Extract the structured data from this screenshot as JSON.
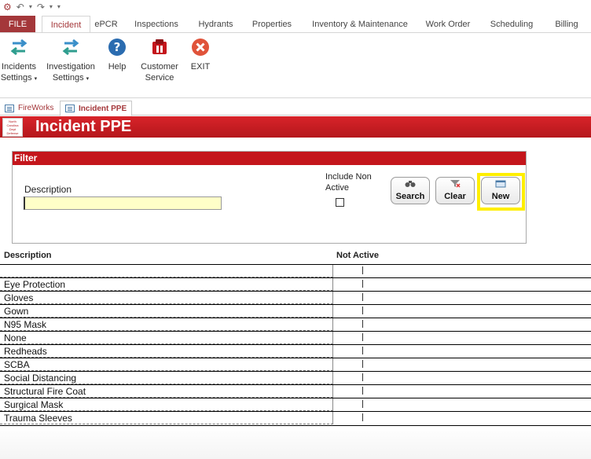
{
  "quick_access": {
    "save_icon": "app-icon",
    "undo_icon": "undo-icon",
    "redo_icon": "redo-icon",
    "customize_icon": "customize-icon"
  },
  "ribbon_tabs": [
    "FILE",
    "Incident",
    "ePCR",
    "Inspections",
    "Hydrants",
    "Properties",
    "Inventory & Maintenance",
    "Work Order",
    "Scheduling",
    "Billing"
  ],
  "ribbon_buttons": [
    {
      "line1": "Incidents",
      "line2": "Settings",
      "icon": "arrows-icon"
    },
    {
      "line1": "Investigation",
      "line2": "Settings",
      "icon": "arrows-icon"
    },
    {
      "line1": "Help",
      "line2": "",
      "icon": "help-icon"
    },
    {
      "line1": "Customer",
      "line2": "Service",
      "icon": "service-icon"
    },
    {
      "line1": "EXIT",
      "line2": "",
      "icon": "exit-icon"
    }
  ],
  "document_tabs": [
    "FireWorks",
    "Incident PPE"
  ],
  "header": {
    "title": "Incident PPE",
    "logo_lines": [
      "North",
      "Carolina",
      "Dept",
      "Defense"
    ]
  },
  "filter": {
    "title": "Filter",
    "description_label": "Description",
    "description_value": "",
    "include_label_1": "Include Non",
    "include_label_2": "Active",
    "include_checked": false,
    "search_label": "Search",
    "clear_label": "Clear",
    "new_label": "New"
  },
  "columns": {
    "description": "Description",
    "not_active": "Not Active"
  },
  "rows": [
    "",
    "Eye Protection",
    "Gloves",
    "Gown",
    "N95 Mask",
    "None",
    "Redheads",
    "SCBA",
    "Social Distancing",
    "Structural Fire Coat",
    "Surgical Mask",
    "Trauma Sleeves"
  ],
  "colors": {
    "accent": "#a4373a",
    "header_red": "#c4161c",
    "highlight": "#ffee00",
    "input_bg": "#ffffc8"
  }
}
